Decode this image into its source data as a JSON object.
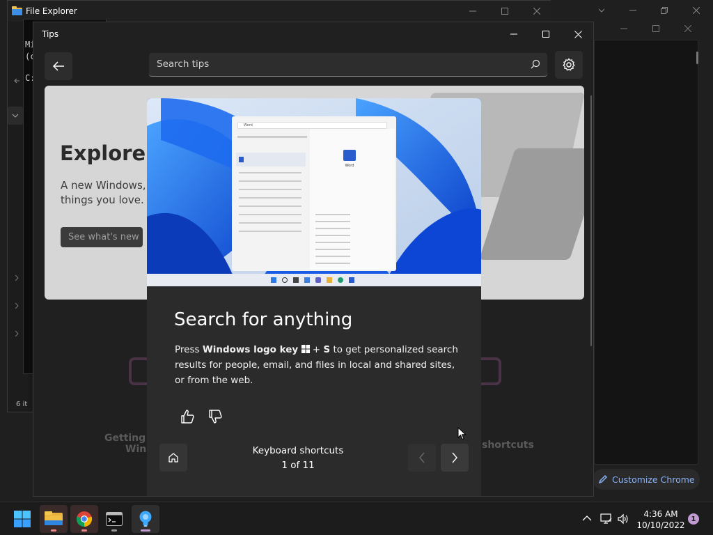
{
  "explorer": {
    "title": "File Explorer",
    "status_text": "6 it"
  },
  "terminal": {
    "lines": [
      "Mi",
      "(c",
      "C:"
    ]
  },
  "chrome": {
    "customize_label": "Customize Chrome"
  },
  "tips": {
    "window_title": "Tips",
    "search_placeholder": "Search tips",
    "hero": {
      "heading": "Explore W",
      "text_line1": "A new Windows,",
      "text_line2": "things you love.",
      "button_label": "See what's new"
    },
    "categories": {
      "left_line1": "Getting a",
      "left_line2": "Win",
      "right_label": "shortcuts"
    },
    "card": {
      "title": "Search for anything",
      "desc_prefix": "Press ",
      "desc_key": "Windows logo key",
      "desc_plus": " + ",
      "desc_key2": "S",
      "desc_suffix": " to get personalized search results for people, email, and files in local and shared sites, or from the web.",
      "illustration": {
        "search_query": "Word",
        "app_name": "Word"
      },
      "nav_title": "Keyboard shortcuts",
      "nav_count": "1 of 11"
    }
  },
  "taskbar": {
    "time": "4:36 AM",
    "date": "10/10/2022",
    "notification_count": "1"
  },
  "colors": {
    "accent_blue": "#1d5fe0",
    "chrome_link": "#8ab4f8",
    "tips_light": "#3ea8ff"
  }
}
